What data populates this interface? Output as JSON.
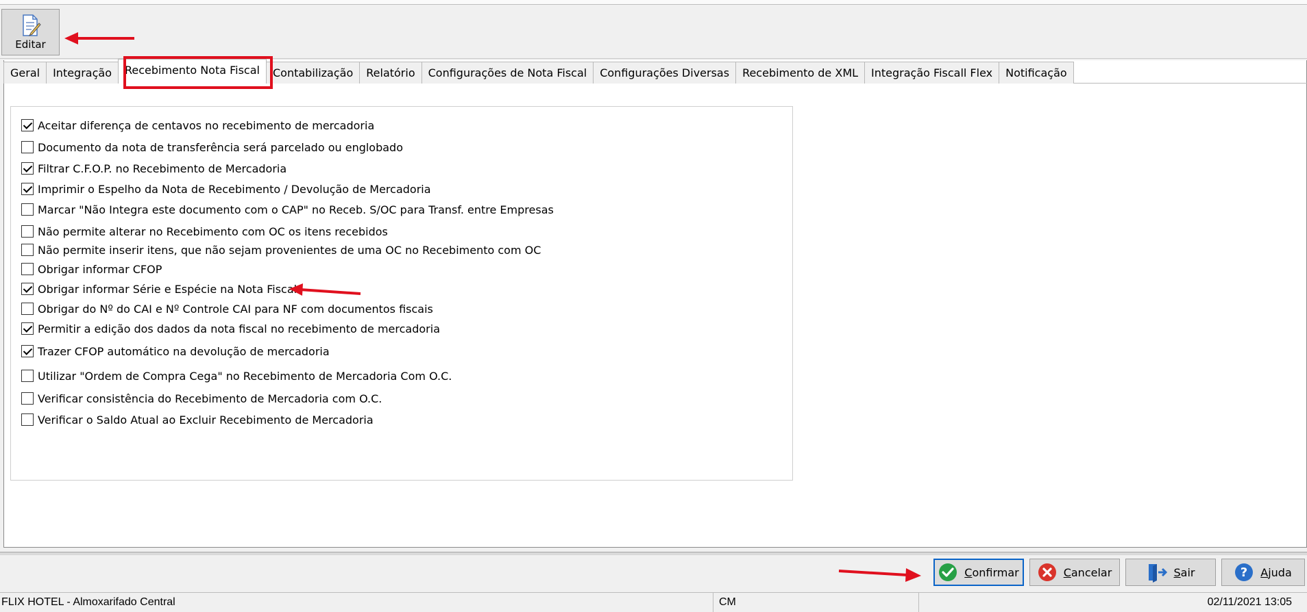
{
  "toolbar": {
    "edit_label": "Editar"
  },
  "tabs": [
    {
      "label": "Geral"
    },
    {
      "label": "Integração"
    },
    {
      "label": "Recebimento Nota Fiscal",
      "active": true
    },
    {
      "label": "Contabilização"
    },
    {
      "label": "Relatório"
    },
    {
      "label": "Configurações de Nota Fiscal"
    },
    {
      "label": "Configurações Diversas"
    },
    {
      "label": "Recebimento de XML"
    },
    {
      "label": "Integração Fiscall Flex"
    },
    {
      "label": "Notificação"
    }
  ],
  "options": [
    {
      "label": "Aceitar diferença de centavos no recebimento de mercadoria",
      "checked": true
    },
    {
      "label": "Documento da nota de transferência será parcelado ou englobado",
      "checked": false
    },
    {
      "label": "Filtrar C.F.O.P. no Recebimento de Mercadoria",
      "checked": true
    },
    {
      "label": "Imprimir o Espelho da Nota de Recebimento / Devolução de Mercadoria",
      "checked": true
    },
    {
      "label": "Marcar \"Não Integra este documento com o CAP\" no Receb. S/OC para Transf. entre Empresas",
      "checked": false
    },
    {
      "label": "Não permite alterar no Recebimento com OC os itens recebidos",
      "checked": false
    },
    {
      "label": "Não permite inserir itens, que não sejam provenientes de uma OC no Recebimento com OC",
      "checked": false
    },
    {
      "label": "Obrigar informar CFOP",
      "checked": false
    },
    {
      "label": "Obrigar informar Série e Espécie na Nota Fiscal",
      "checked": true
    },
    {
      "label": "Obrigar do Nº do CAI e Nº Controle CAI para NF com documentos fiscais",
      "checked": false
    },
    {
      "label": "Permitir a edição dos dados da nota fiscal no recebimento de mercadoria",
      "checked": true
    },
    {
      "label": "Trazer CFOP automático na devolução de mercadoria",
      "checked": true
    },
    {
      "label": "Utilizar \"Ordem de Compra Cega\" no Recebimento de Mercadoria Com O.C.",
      "checked": false
    },
    {
      "label": "Verificar consistência do Recebimento de Mercadoria com O.C.",
      "checked": false
    },
    {
      "label": "Verificar o Saldo Atual ao Excluir Recebimento de Mercadoria",
      "checked": false
    }
  ],
  "buttons": {
    "confirm": {
      "first": "C",
      "rest": "onfirmar"
    },
    "cancel": {
      "first": "C",
      "rest": "ancelar"
    },
    "exit": {
      "first": "S",
      "rest": "air"
    },
    "help": {
      "first": "A",
      "rest": "juda"
    }
  },
  "status": {
    "company": "FLIX HOTEL - Almoxarifado Central",
    "code": "CM",
    "datetime": "02/11/2021 13:05"
  },
  "colors": {
    "annotation_red": "#e0101e",
    "primary_border": "#0a64c8",
    "ok_green": "#27a046",
    "cancel_red": "#d9342b",
    "blue_icon": "#2a6fc9"
  },
  "icons": [
    "edit-document-icon",
    "check-circle-icon",
    "x-circle-icon",
    "exit-door-icon",
    "question-circle-icon"
  ]
}
